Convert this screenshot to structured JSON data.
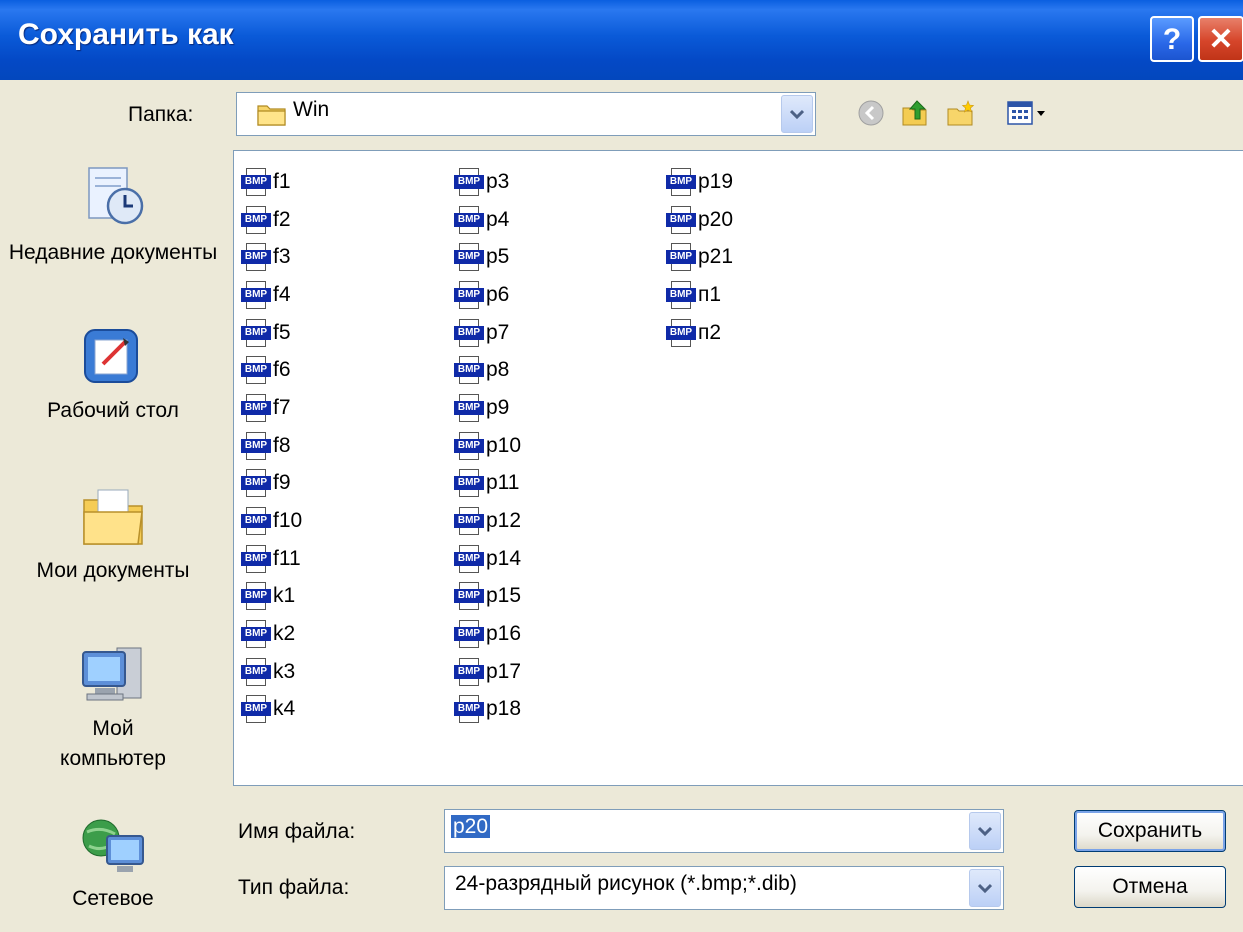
{
  "window": {
    "title": "Сохранить как",
    "help_label": "?",
    "close_label": "✕"
  },
  "folder": {
    "label": "Папка:",
    "value": "Win",
    "icon": "folder-icon"
  },
  "toolbar": {
    "icons": [
      "back-icon",
      "up-folder-icon",
      "new-folder-icon",
      "view-menu-icon"
    ]
  },
  "places": [
    {
      "label": "Недавние документы",
      "icon": "recent-documents-icon"
    },
    {
      "label": "Рабочий стол",
      "icon": "desktop-icon"
    },
    {
      "label": "Мои документы",
      "icon": "my-documents-icon"
    },
    {
      "label": "Мой компьютер",
      "icon": "my-computer-icon"
    },
    {
      "label": "Сетевое",
      "icon": "network-icon"
    }
  ],
  "files": {
    "columns": [
      [
        "f1",
        "f2",
        "f3",
        "f4",
        "f5",
        "f6",
        "f7",
        "f8",
        "f9",
        "f10",
        "f11",
        "k1",
        "k2",
        "k3",
        "k4"
      ],
      [
        "p3",
        "p4",
        "p5",
        "p6",
        "p7",
        "p8",
        "p9",
        "p10",
        "p11",
        "p12",
        "p14",
        "p15",
        "p16",
        "p17",
        "p18"
      ],
      [
        "p19",
        "p20",
        "p21",
        "п1",
        "п2"
      ]
    ],
    "icon_tag": "BMP"
  },
  "filename": {
    "label": "Имя файла:",
    "value": "p20"
  },
  "filetype": {
    "label": "Тип файла:",
    "value": "24-разрядный рисунок (*.bmp;*.dib)"
  },
  "buttons": {
    "save": "Сохранить",
    "cancel": "Отмена"
  },
  "colors": {
    "titlebar": "#0a5ad8",
    "selection": "#316ac5",
    "bmp_tag": "#0f2aa8"
  }
}
